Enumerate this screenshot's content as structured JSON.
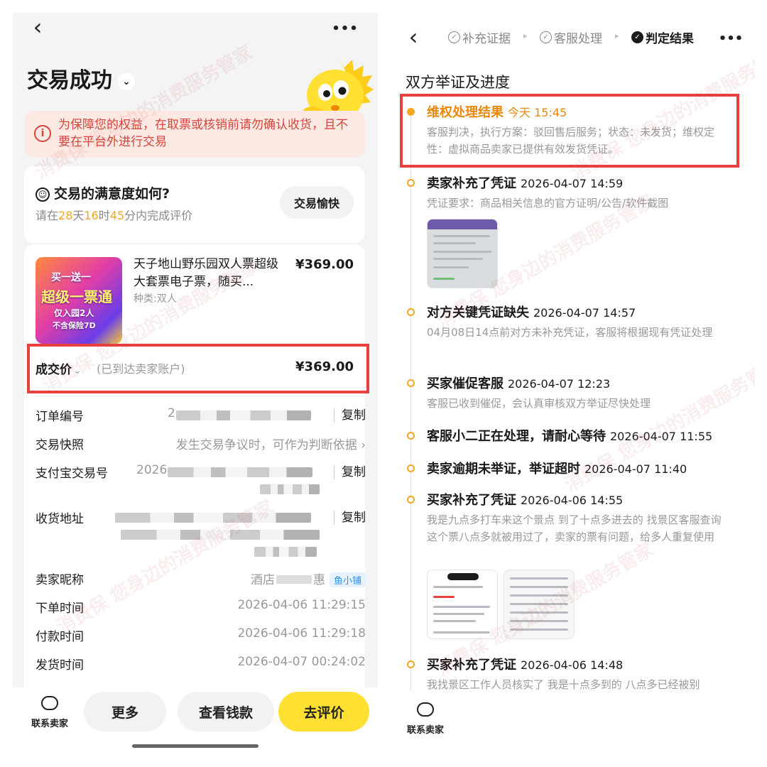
{
  "left": {
    "title": "交易成功",
    "title_chevron": "⌄",
    "more_icon": "•••",
    "back_icon": "‹",
    "notice_icon": "i",
    "notice_text": "为保障您的权益，在取票或核销前请勿确认收货，且不要在平台外进行交易",
    "satisfaction": {
      "icon": "☺",
      "title": "交易的满意度如何?",
      "sub_prefix": "请在",
      "days": "28",
      "days_unit": "天",
      "hours": "16",
      "hours_unit": "时",
      "minutes": "45",
      "sub_suffix": "分内完成评价",
      "button": "交易愉快"
    },
    "product": {
      "image_text_1": "买一送一",
      "image_text_2": "超级一票通",
      "image_text_3": "仅入园2人",
      "image_text_4": "不含保险7D",
      "name": "天子地山野乐园双人票超级大套票电子票，随买...",
      "type": "种类:双人",
      "price": "¥369.00"
    },
    "deal": {
      "label": "成交价",
      "chevron": "⌄",
      "note": "(已到达卖家账户)",
      "price": "¥369.00"
    },
    "info": [
      {
        "key": "订单编号",
        "value": "2",
        "action": "复制"
      },
      {
        "key": "交易快照",
        "value": "发生交易争议时，可作为判断依据 ›"
      },
      {
        "key": "支付宝交易号",
        "value": "2026",
        "action": "复制"
      },
      {
        "key": "收货地址",
        "value": "",
        "action": "复制"
      },
      {
        "key": "卖家昵称",
        "value": "酒店",
        "value2": "惠",
        "tag": "鱼小铺"
      },
      {
        "key": "下单时间",
        "value": "2026-04-06 11:29:15"
      },
      {
        "key": "付款时间",
        "value": "2026-04-06 11:29:18"
      },
      {
        "key": "发货时间",
        "value": "2026-04-07 00:24:02"
      }
    ],
    "bottom": {
      "contact": "联系卖家",
      "more": "更多",
      "view_money": "查看钱款",
      "review": "去评价"
    },
    "watermark": "消费保 您身边的消费服务管家"
  },
  "right": {
    "back_icon": "‹",
    "more_icon": "•••",
    "steps": [
      {
        "label": "补充证据",
        "icon": "✓"
      },
      {
        "label": "客服处理",
        "icon": "✓"
      },
      {
        "label": "判定结果",
        "icon": "✓"
      }
    ],
    "step_sep": "▸",
    "section_title": "双方举证及进度",
    "timeline": [
      {
        "title": "维权处理结果",
        "time": "今天 15:45",
        "body": "客服判决，执行方案：驳回售后服务；状态：未发货；维权定性：虚拟商品卖家已提供有效发货凭证。"
      },
      {
        "title": "卖家补充了凭证",
        "time": "2026-04-07 14:59",
        "body": "凭证要求：商品相关信息的官方证明/公告/软件截图"
      },
      {
        "title": "对方关键凭证缺失",
        "time": "2026-04-07 14:57",
        "body": "04月08日14点前对方未补充凭证，客服将根据现有凭证处理"
      },
      {
        "title": "买家催促客服",
        "time": "2026-04-07 12:23",
        "body": "客服已收到催促，会认真审核双方举证尽快处理"
      },
      {
        "title": "客服小二正在处理，请耐心等待",
        "time": "2026-04-07 11:55",
        "body": ""
      },
      {
        "title": "卖家逾期未举证，举证超时",
        "time": "2026-04-07 11:40",
        "body": ""
      },
      {
        "title": "买家补充了凭证",
        "time": "2026-04-06 14:55",
        "body": "我是九点多打车来这个景点 到了十点多进去的 找景区客服查询这个票八点多就被用过了，卖家的票有问题，给多人重复使用"
      },
      {
        "title": "买家补充了凭证",
        "time": "2026-04-06 14:48",
        "body": "我找景区工作人员核实了 我是十点多到的 八点多已经被别"
      }
    ],
    "bottom": {
      "contact": "联系卖家"
    }
  },
  "colors": {
    "accent_yellow": "#ffe033",
    "highlight_red": "#e8403e",
    "orange": "#e8890c",
    "notice_red": "#d8443a"
  }
}
